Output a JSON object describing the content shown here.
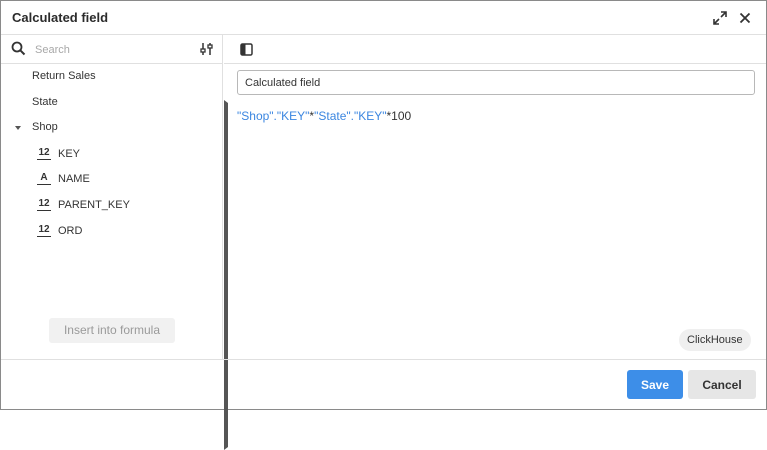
{
  "dialog": {
    "title": "Calculated field"
  },
  "search": {
    "placeholder": "Search",
    "value": ""
  },
  "tree": {
    "items": [
      {
        "label": "Return Sales",
        "expanded": false
      },
      {
        "label": "State",
        "expanded": false
      },
      {
        "label": "Shop",
        "expanded": true
      }
    ],
    "fields": [
      {
        "type_icon": "12",
        "type": "number",
        "label": "KEY"
      },
      {
        "type_icon": "A",
        "type": "text",
        "label": "NAME"
      },
      {
        "type_icon": "12",
        "type": "number",
        "label": "PARENT_KEY"
      },
      {
        "type_icon": "12",
        "type": "number",
        "label": "ORD"
      }
    ]
  },
  "insert_button": {
    "label": "Insert into formula",
    "disabled": true
  },
  "editor": {
    "name_value": "Calculated field",
    "formula": {
      "shop": "\"Shop\"",
      "dot1": ".",
      "key1": "\"KEY\"",
      "mul1": "*",
      "state": "\"State\"",
      "dot2": ".",
      "key2": "\"KEY\"",
      "mul2": "*100"
    },
    "dialect": "ClickHouse"
  },
  "footer": {
    "save_label": "Save",
    "cancel_label": "Cancel"
  },
  "colors": {
    "accent": "#3d8ee8",
    "formula_ref": "#3b86e0"
  }
}
